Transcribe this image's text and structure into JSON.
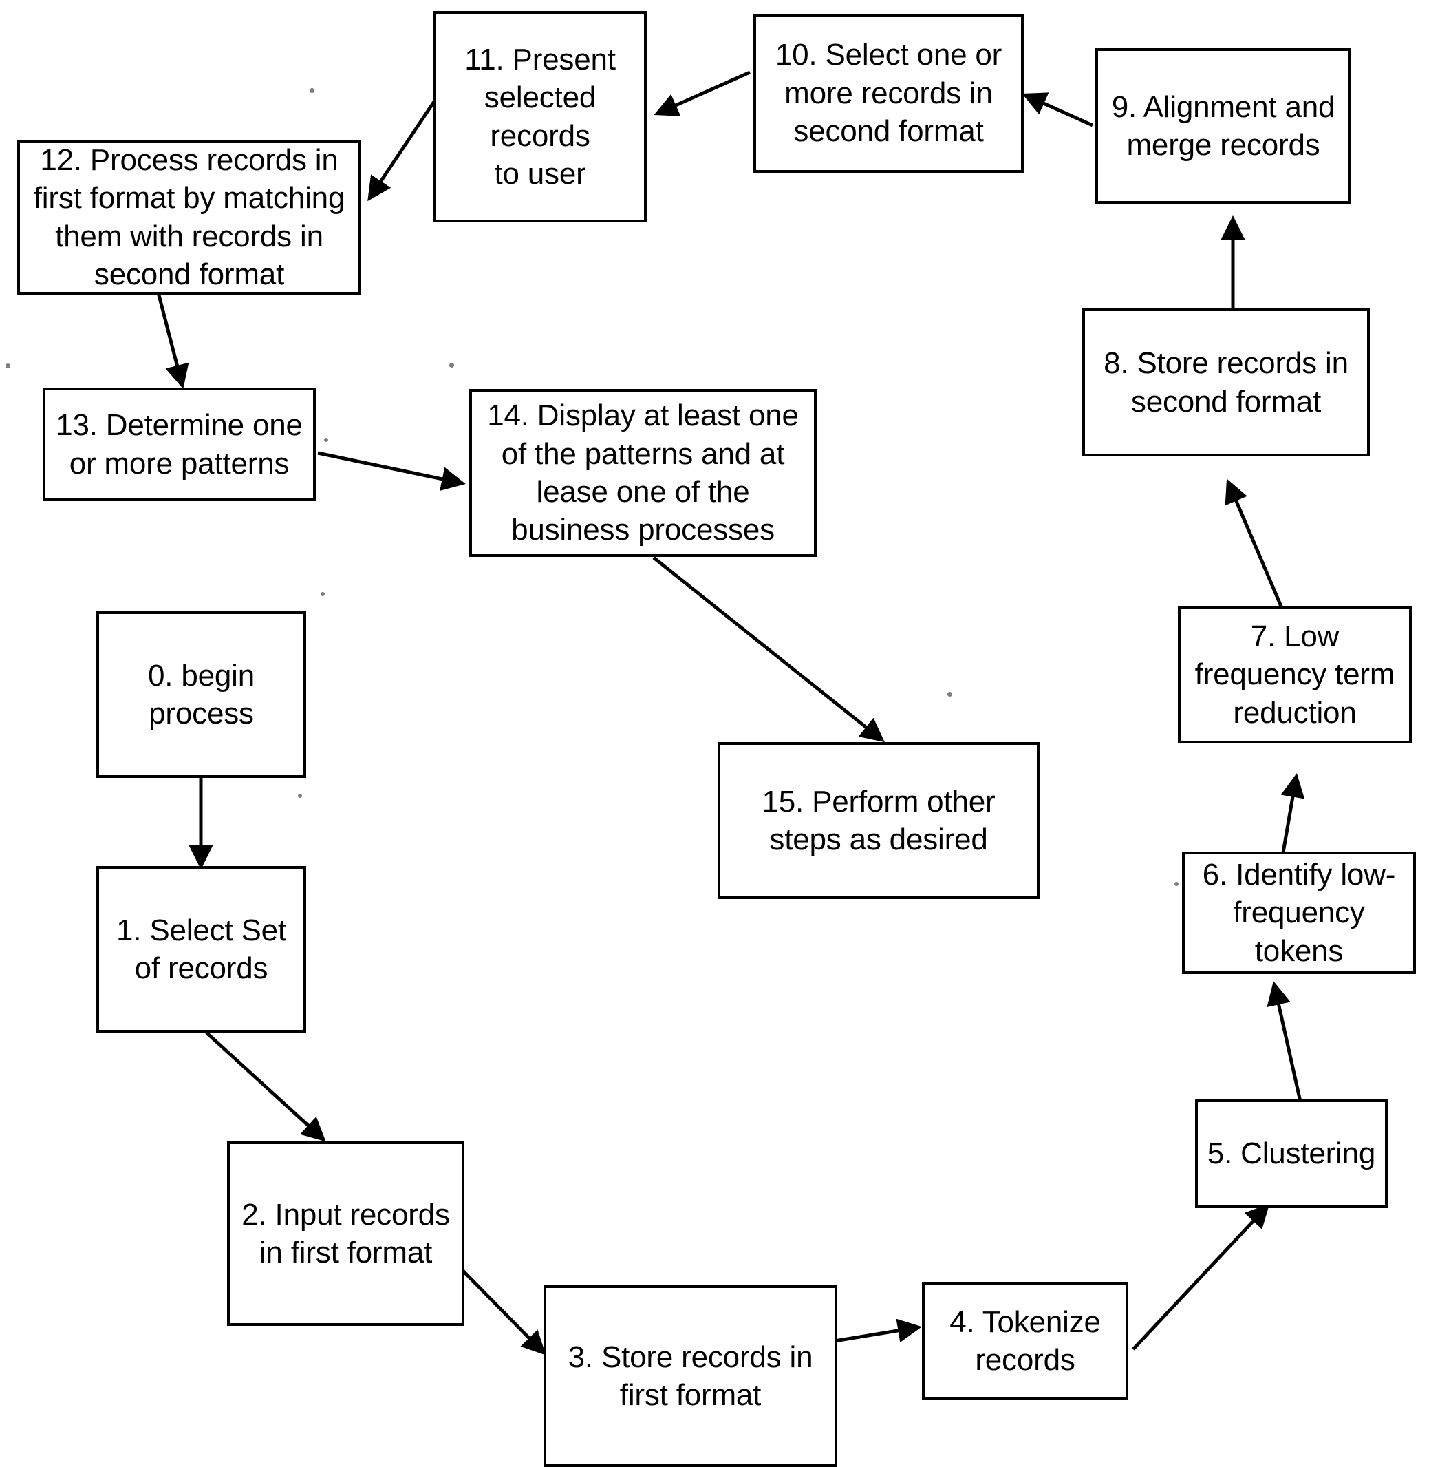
{
  "diagram": {
    "type": "flowchart",
    "title": "Record processing flowchart",
    "nodes": [
      {
        "id": "n0",
        "number": "0.",
        "label": "0.  begin\nprocess"
      },
      {
        "id": "n1",
        "number": "1.",
        "label": "1.  Select Set\nof records"
      },
      {
        "id": "n2",
        "number": "2.",
        "label": "2.  Input records\nin first format"
      },
      {
        "id": "n3",
        "number": "3.",
        "label": "3.  Store records in\nfirst format"
      },
      {
        "id": "n4",
        "number": "4.",
        "label": "4.  Tokenize\nrecords"
      },
      {
        "id": "n5",
        "number": "5.",
        "label": "5.  Clustering"
      },
      {
        "id": "n6",
        "number": "6.",
        "label": "6.  Identify low-\nfrequency tokens"
      },
      {
        "id": "n7",
        "number": "7.",
        "label": "7.  Low\nfrequency term\nreduction"
      },
      {
        "id": "n8",
        "number": "8.",
        "label": "8.  Store records in\nsecond format"
      },
      {
        "id": "n9",
        "number": "9.",
        "label": "9.  Alignment and\nmerge records"
      },
      {
        "id": "n10",
        "number": "10.",
        "label": "10.  Select one or\nmore records in\nsecond format"
      },
      {
        "id": "n11",
        "number": "11.",
        "label": "11.  Present\nselected\nrecords\nto user"
      },
      {
        "id": "n12",
        "number": "12.",
        "label": "12.  Process records in\nfirst format by matching\nthem with records in\nsecond format"
      },
      {
        "id": "n13",
        "number": "13.",
        "label": "13.  Determine one\nor more patterns"
      },
      {
        "id": "n14",
        "number": "14.",
        "label": "14.  Display at least one\nof the patterns and at\nlease one of the\nbusiness processes"
      },
      {
        "id": "n15",
        "number": "15.",
        "label": "15.  Perform other\nsteps as desired"
      }
    ],
    "edges": [
      {
        "from": "n0",
        "to": "n1"
      },
      {
        "from": "n1",
        "to": "n2"
      },
      {
        "from": "n2",
        "to": "n3"
      },
      {
        "from": "n3",
        "to": "n4"
      },
      {
        "from": "n4",
        "to": "n5"
      },
      {
        "from": "n5",
        "to": "n6"
      },
      {
        "from": "n6",
        "to": "n7"
      },
      {
        "from": "n7",
        "to": "n8"
      },
      {
        "from": "n8",
        "to": "n9"
      },
      {
        "from": "n9",
        "to": "n10"
      },
      {
        "from": "n10",
        "to": "n11"
      },
      {
        "from": "n11",
        "to": "n12"
      },
      {
        "from": "n12",
        "to": "n13"
      },
      {
        "from": "n13",
        "to": "n14"
      },
      {
        "from": "n14",
        "to": "n15"
      }
    ],
    "colors": {
      "stroke": "#000000",
      "fill": "#ffffff",
      "text": "#000000"
    }
  }
}
